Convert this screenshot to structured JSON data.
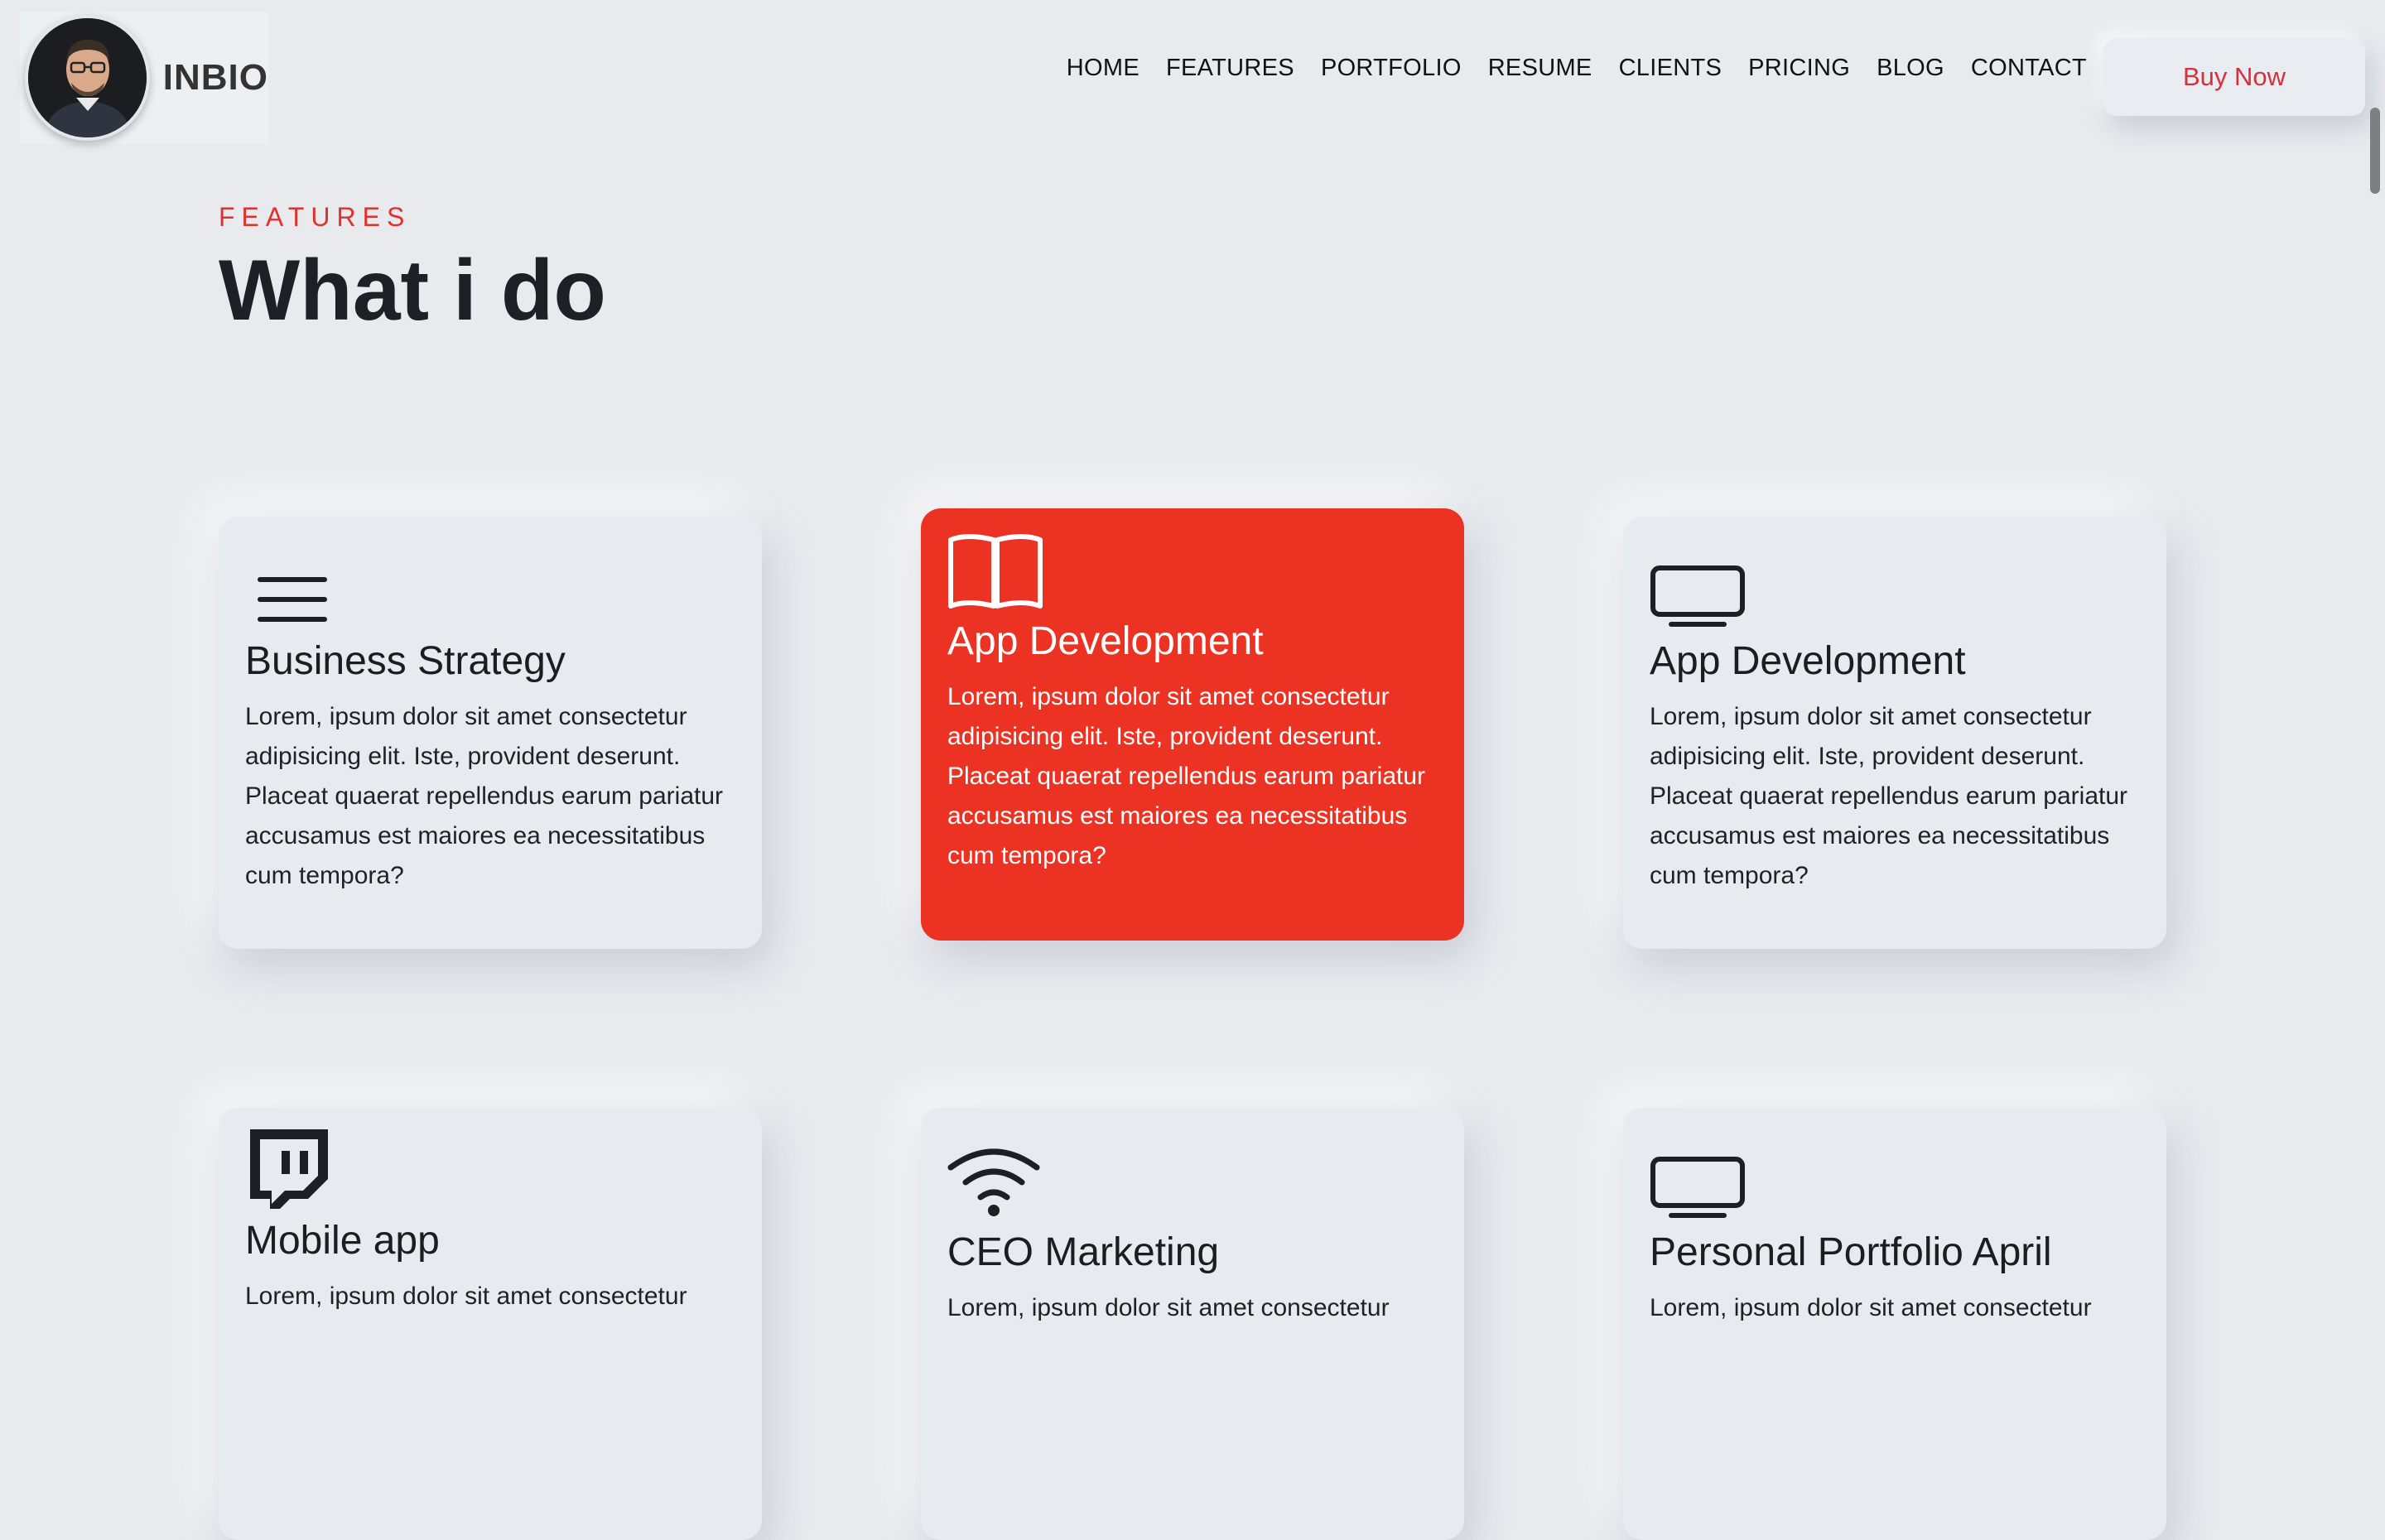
{
  "brand": {
    "name": "INBIO"
  },
  "nav": {
    "items": [
      "HOME",
      "FEATURES",
      "PORTFOLIO",
      "RESUME",
      "CLIENTS",
      "PRICING",
      "BLOG",
      "CONTACT"
    ],
    "buy_label": "Buy Now"
  },
  "section": {
    "eyebrow": "FEATURES",
    "title": "What i do"
  },
  "cards": [
    {
      "icon": "menu-icon",
      "title": "Business Strategy",
      "text": "Lorem, ipsum dolor sit amet consectetur adipisicing elit. Iste, provident deserunt. Placeat quaerat repellendus earum pariatur accusamus est maiores ea necessitatibus cum tempora?"
    },
    {
      "icon": "book-open-icon",
      "title": "App Development",
      "text": "Lorem, ipsum dolor sit amet consectetur adipisicing elit. Iste, provident deserunt. Placeat quaerat repellendus earum pariatur accusamus est maiores ea necessitatibus cum tempora?"
    },
    {
      "icon": "monitor-icon",
      "title": "App Development",
      "text": "Lorem, ipsum dolor sit amet consectetur adipisicing elit. Iste, provident deserunt. Placeat quaerat repellendus earum pariatur accusamus est maiores ea necessitatibus cum tempora?"
    },
    {
      "icon": "twitch-icon",
      "title": "Mobile app",
      "text": "Lorem, ipsum dolor sit amet consectetur"
    },
    {
      "icon": "wifi-icon",
      "title": "CEO Marketing",
      "text": "Lorem, ipsum dolor sit amet consectetur"
    },
    {
      "icon": "monitor-icon",
      "title": "Personal Portfolio April",
      "text": "Lorem, ipsum dolor sit amet consectetur"
    }
  ],
  "colors": {
    "background": "#e8eaee",
    "accent": "#ec3222",
    "buy_text": "#d6303c"
  }
}
